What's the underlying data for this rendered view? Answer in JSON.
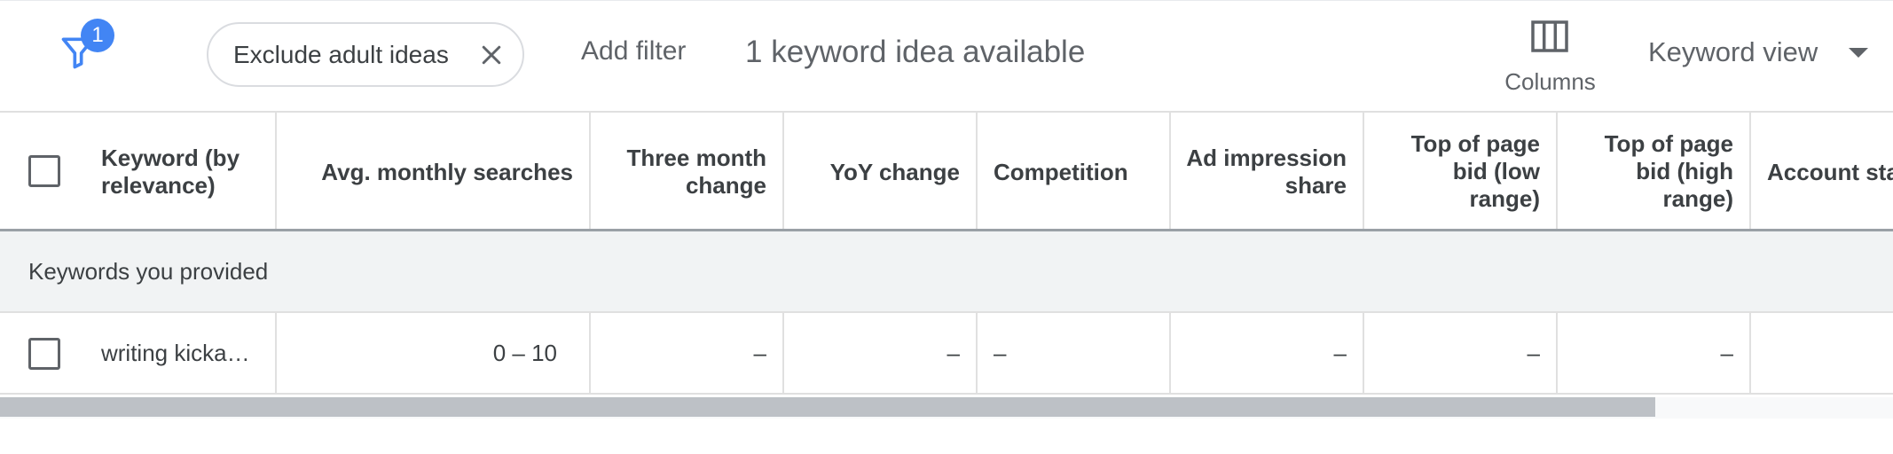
{
  "toolbar": {
    "filter_badge_count": "1",
    "chip_label": "Exclude adult ideas",
    "add_filter_label": "Add filter",
    "idea_count_text": "1 keyword idea available",
    "columns_label": "Columns",
    "view_select_label": "Keyword view"
  },
  "table": {
    "headers": {
      "keyword": "Keyword (by relevance)",
      "keyword_line1": "Keyword (by",
      "keyword_line2": "relevance)",
      "avg_monthly": "Avg. monthly searches",
      "three_month_line1": "Three month",
      "three_month_line2": "change",
      "yoy": "YoY change",
      "competition": "Competition",
      "ad_impression_line1": "Ad impression",
      "ad_impression_line2": "share",
      "bid_low_line1": "Top of page",
      "bid_low_line2": "bid (low",
      "bid_low_line3": "range)",
      "bid_high_line1": "Top of page",
      "bid_high_line2": "bid (high",
      "bid_high_line3": "range)",
      "account_status": "Account sta"
    },
    "section_label": "Keywords you provided",
    "rows": [
      {
        "keyword": "writing kicka…",
        "avg_monthly": "0 – 10",
        "three_month": "–",
        "yoy": "–",
        "competition": "–",
        "ad_impression": "–",
        "bid_low": "–",
        "bid_high": "–"
      }
    ]
  },
  "icons": {
    "filter": "filter-icon",
    "close": "close-icon",
    "columns": "columns-icon",
    "dropdown": "arrow-drop-down-icon"
  },
  "colors": {
    "accent": "#4285f4",
    "text": "#3c4043",
    "muted": "#5f6368",
    "section_bg": "#f1f3f4",
    "scroll_thumb": "#bdc1c6"
  }
}
